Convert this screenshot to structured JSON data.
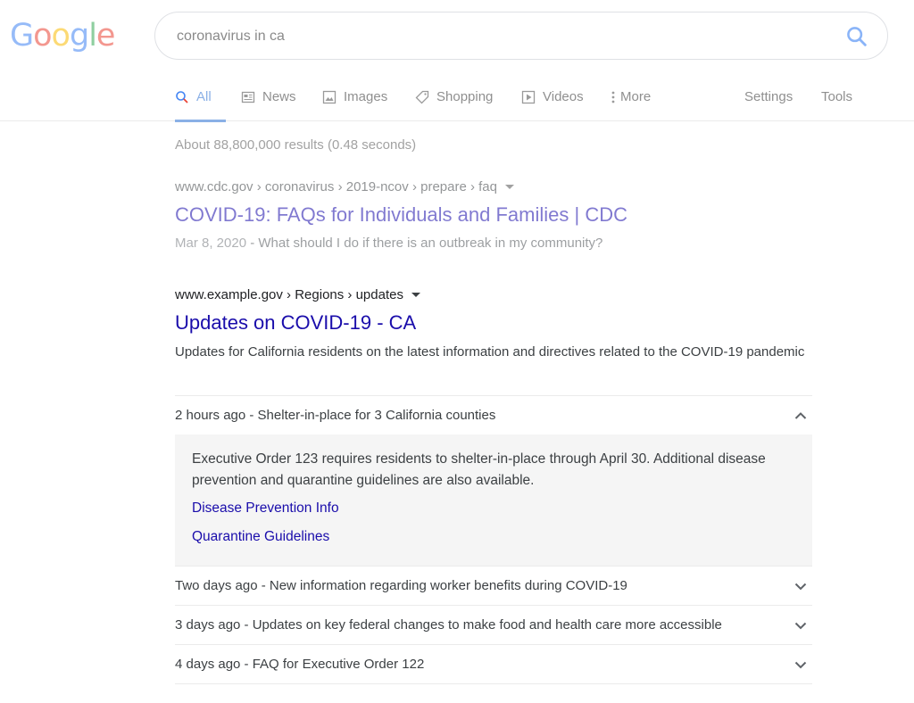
{
  "logo": {
    "text": "Google",
    "letters": [
      "G",
      "o",
      "o",
      "g",
      "l",
      "e"
    ],
    "colors": [
      "#4285f4",
      "#ea4335",
      "#fbbc05",
      "#4285f4",
      "#34a853",
      "#ea4335"
    ]
  },
  "search": {
    "query": "coronavirus in ca",
    "icon": "search-icon"
  },
  "tabs": [
    {
      "label": "All",
      "icon": "search-icon",
      "active": true
    },
    {
      "label": "News",
      "icon": "news-icon"
    },
    {
      "label": "Images",
      "icon": "image-icon"
    },
    {
      "label": "Shopping",
      "icon": "tag-icon"
    },
    {
      "label": "Videos",
      "icon": "play-icon"
    },
    {
      "label": "More",
      "icon": "more-vert-icon"
    },
    {
      "label": "Settings"
    },
    {
      "label": "Tools"
    }
  ],
  "stats": "About 88,800,000 results (0.48 seconds)",
  "result1": {
    "cite": "www.cdc.gov › coronavirus › 2019-ncov › prepare › faq",
    "title": "COVID-19: FAQs for Individuals and Families | CDC",
    "date": "Mar 8, 2020",
    "snippet": " - What should I do if there is an outbreak in my community?"
  },
  "result2": {
    "cite": "www.example.gov › Regions › updates",
    "title": "Updates on COVID-19 - CA",
    "description": "Updates for California residents on the latest information and directives related to the COVID-19 pandemic",
    "updates": [
      {
        "label": "2 hours ago - Shelter-in-place for 3 California counties",
        "expanded": true
      },
      {
        "label": "Two days ago - New information regarding worker benefits during COVID-19",
        "expanded": false
      },
      {
        "label": "3 days ago - Updates on key federal changes to make food and health care more accessible",
        "expanded": false
      },
      {
        "label": "4 days ago - FAQ for Executive Order 122",
        "expanded": false
      }
    ],
    "panel": {
      "text": "Executive Order 123 requires residents to shelter-in-place through April 30. Additional disease prevention and quarantine guidelines are also available.",
      "links": [
        "Disease Prevention Info",
        "Quarantine Guidelines"
      ]
    }
  },
  "colors": {
    "link": "#1a0dab",
    "tab_active": "#8ab0e6",
    "muted": "#8f8f8f"
  }
}
